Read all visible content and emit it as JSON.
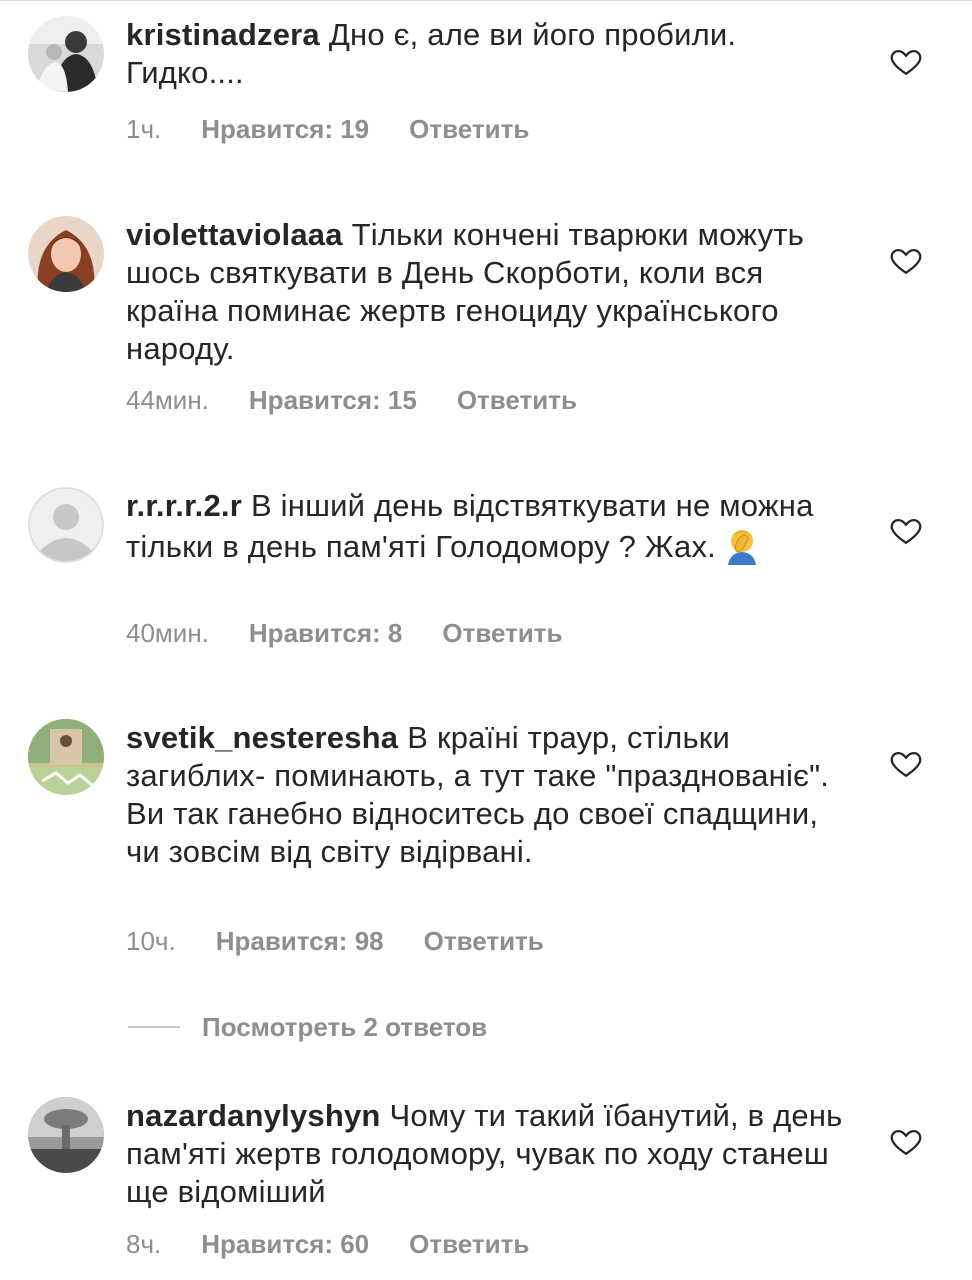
{
  "comments": [
    {
      "username": "kristinadzera",
      "text": "Дно є, але ви його пробили. Гидко....",
      "time": "1ч.",
      "likes": "Нравится: 19",
      "reply": "Ответить"
    },
    {
      "username": "violettaviolaaa",
      "text": "Тільки кончені тварюки можуть шось святкувати в День Скорботи, коли вся країна поминає жертв геноциду українського народу.",
      "time": "44мин.",
      "likes": "Нравится: 15",
      "reply": "Ответить"
    },
    {
      "username": "r.r.r.r.2.r",
      "text": "В інший день відствяткувати не можна тільки в день пам'яті Голодомору ? Жах.",
      "emoji": "facepalm",
      "time": "40мин.",
      "likes": "Нравится: 8",
      "reply": "Ответить"
    },
    {
      "username": "svetik_nesteresha",
      "text": "В країні траур, стільки загиблих- поминають, а тут таке \"празднованіє\". Ви так ганебно відноситесь до своеї спадщини, чи зовсім від світу відірвані.",
      "time": "10ч.",
      "likes": "Нравится: 98",
      "reply": "Ответить",
      "view_replies": "Посмотреть 2 ответов"
    },
    {
      "username": "nazardanylyshyn",
      "text": "Чому ти такий їбанутий, в день пам'яті жертв голодомору, чувак по ходу станеш ще відоміший",
      "time": "8ч.",
      "likes": "Нравится: 60",
      "reply": "Ответить"
    }
  ],
  "icons": {
    "like": "heart-outline-icon",
    "avatar_default": "default-avatar-icon"
  },
  "colors": {
    "text": "#262626",
    "meta": "#8e8e8e",
    "divider": "#dbdbdb"
  }
}
